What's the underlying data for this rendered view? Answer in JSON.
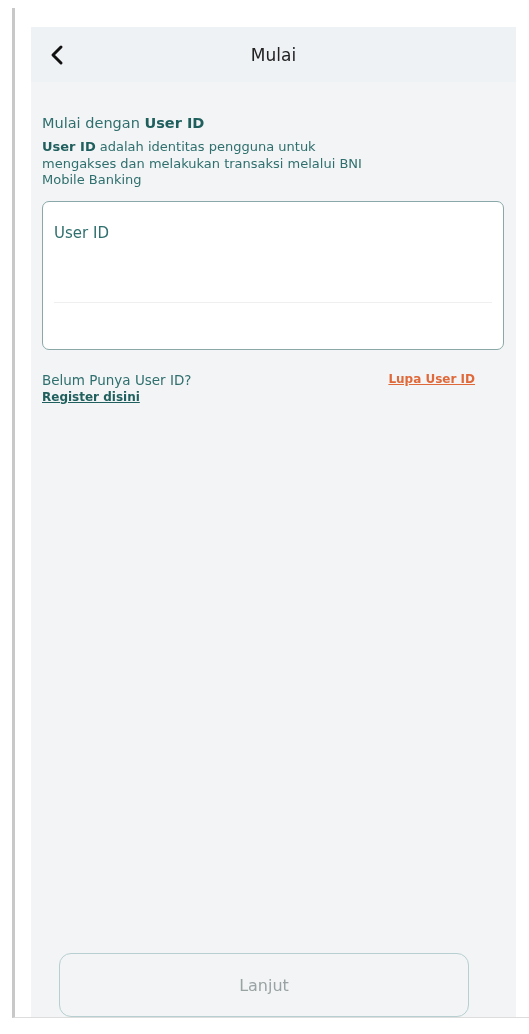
{
  "header": {
    "title": "Mulai"
  },
  "intro": {
    "heading": "Mulai dengan **User ID**",
    "description": "**User ID** adalah identitas pengguna untuk mengakses dan melakukan transaksi melalui BNI Mobile Banking"
  },
  "user_id_field": {
    "placeholder": "User ID"
  },
  "links": {
    "question": "Belum Punya User ID?",
    "register": "Register disini",
    "forgot": "Lupa User ID"
  },
  "continue_button": {
    "label": "Lanjut",
    "disabled": true
  }
}
